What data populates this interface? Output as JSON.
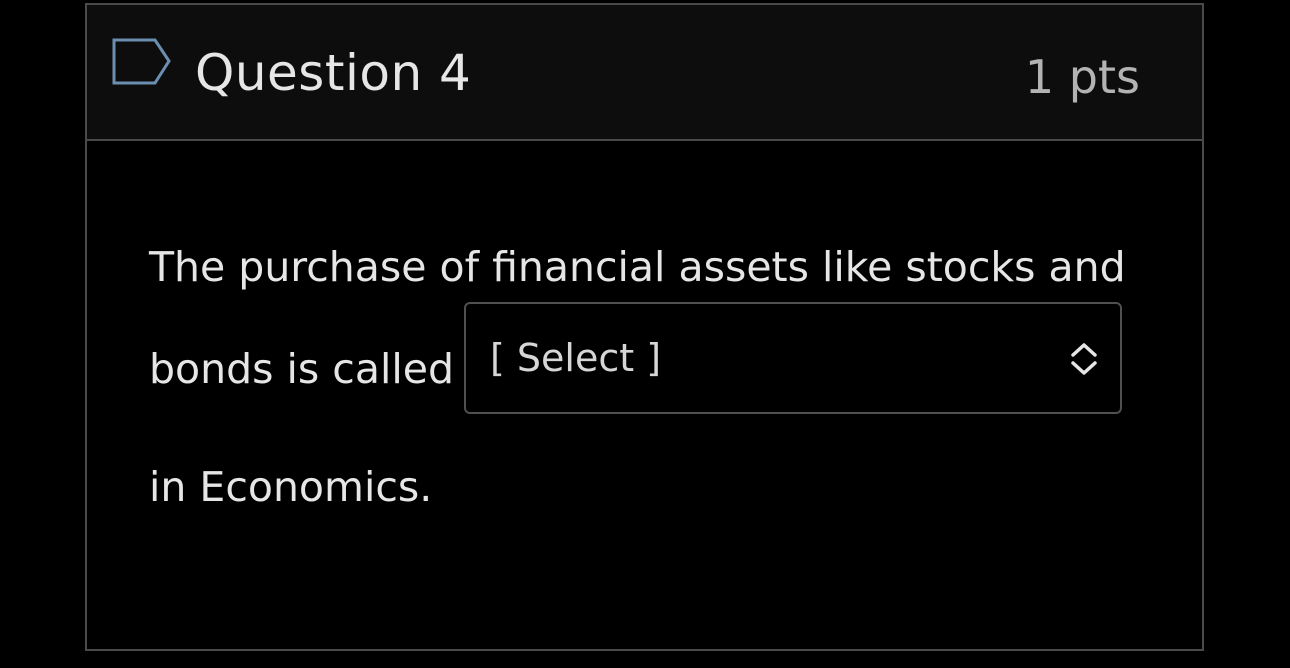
{
  "question": {
    "title": "Question 4",
    "points": "1 pts",
    "flag_icon": "flag-outline-icon",
    "text_line_1": "The purchase of financial assets like stocks and",
    "text_line_2": "bonds is called",
    "text_line_3": "in Economics.",
    "answer_select": {
      "selected": "[ Select ]",
      "icon": "up-down-chevron-icon"
    }
  },
  "colors": {
    "background": "#000000",
    "header_background": "#0d0d0d",
    "border": "#4a4a4a",
    "text": "#e6e6e6",
    "points_text": "#b3b3b3",
    "flag_stroke": "#6b8fb0"
  }
}
